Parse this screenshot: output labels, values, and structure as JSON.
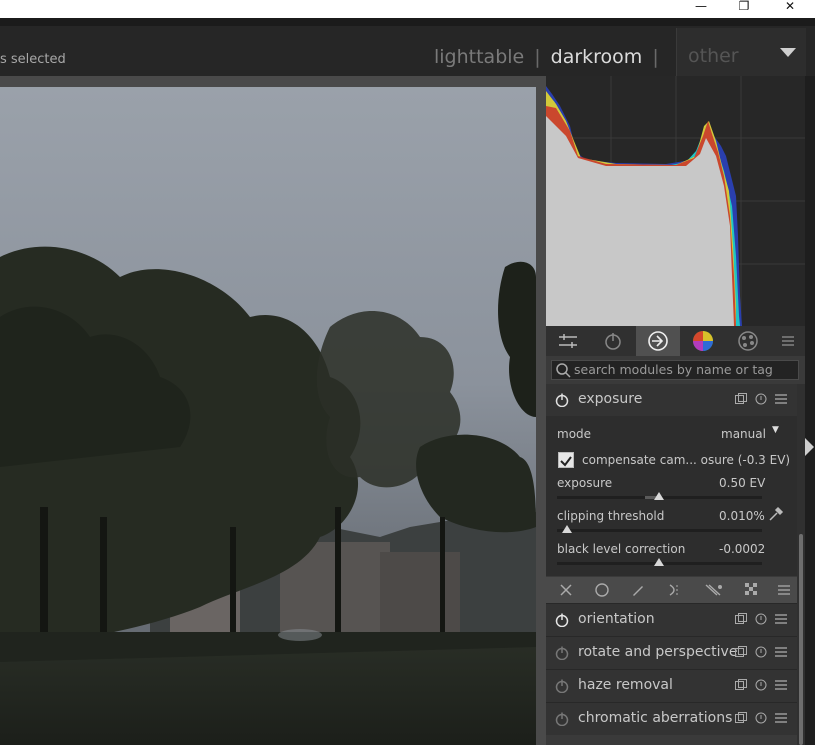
{
  "window_controls": {
    "minimize": "—",
    "restore": "❐",
    "close": "✕"
  },
  "header": {
    "selection_text": "s selected",
    "views": [
      {
        "label": "lighttable",
        "active": false
      },
      {
        "label": "darkroom",
        "active": true
      }
    ],
    "separator": "|",
    "other_label": "other"
  },
  "panel_tabs": [
    {
      "icon": "sliders-icon"
    },
    {
      "icon": "power-icon"
    },
    {
      "icon": "active-modules-icon",
      "active": true
    },
    {
      "icon": "color-wheel-icon"
    },
    {
      "icon": "palette-icon"
    },
    {
      "icon": "menu-icon"
    }
  ],
  "search": {
    "placeholder": "search modules by name or tag"
  },
  "exposure_module": {
    "name": "exposure",
    "mode_label": "mode",
    "mode_value": "manual",
    "compensate_label": "compensate cam... osure (-0.3 EV)",
    "compensate_checked": true,
    "exposure_label": "exposure",
    "exposure_value": "0.50 EV",
    "clipping_label": "clipping threshold",
    "clipping_value": "0.010%",
    "black_label": "black level correction",
    "black_value": "-0.0002"
  },
  "group_tabs": [
    {
      "icon": "close-icon"
    },
    {
      "icon": "circle-icon"
    },
    {
      "icon": "pencil-icon"
    },
    {
      "icon": "lens-icon"
    },
    {
      "icon": "enhance-icon"
    },
    {
      "icon": "checker-icon"
    },
    {
      "icon": "menu-icon"
    }
  ],
  "modules": [
    {
      "name": "orientation",
      "enabled": true
    },
    {
      "name": "rotate and perspective",
      "enabled": false
    },
    {
      "name": "haze removal",
      "enabled": false
    },
    {
      "name": "chromatic aberrations",
      "enabled": false
    }
  ],
  "colors": {
    "accent_bg": "#262626",
    "panel_bg": "#3a3a3a",
    "active_tab": "#505050"
  }
}
